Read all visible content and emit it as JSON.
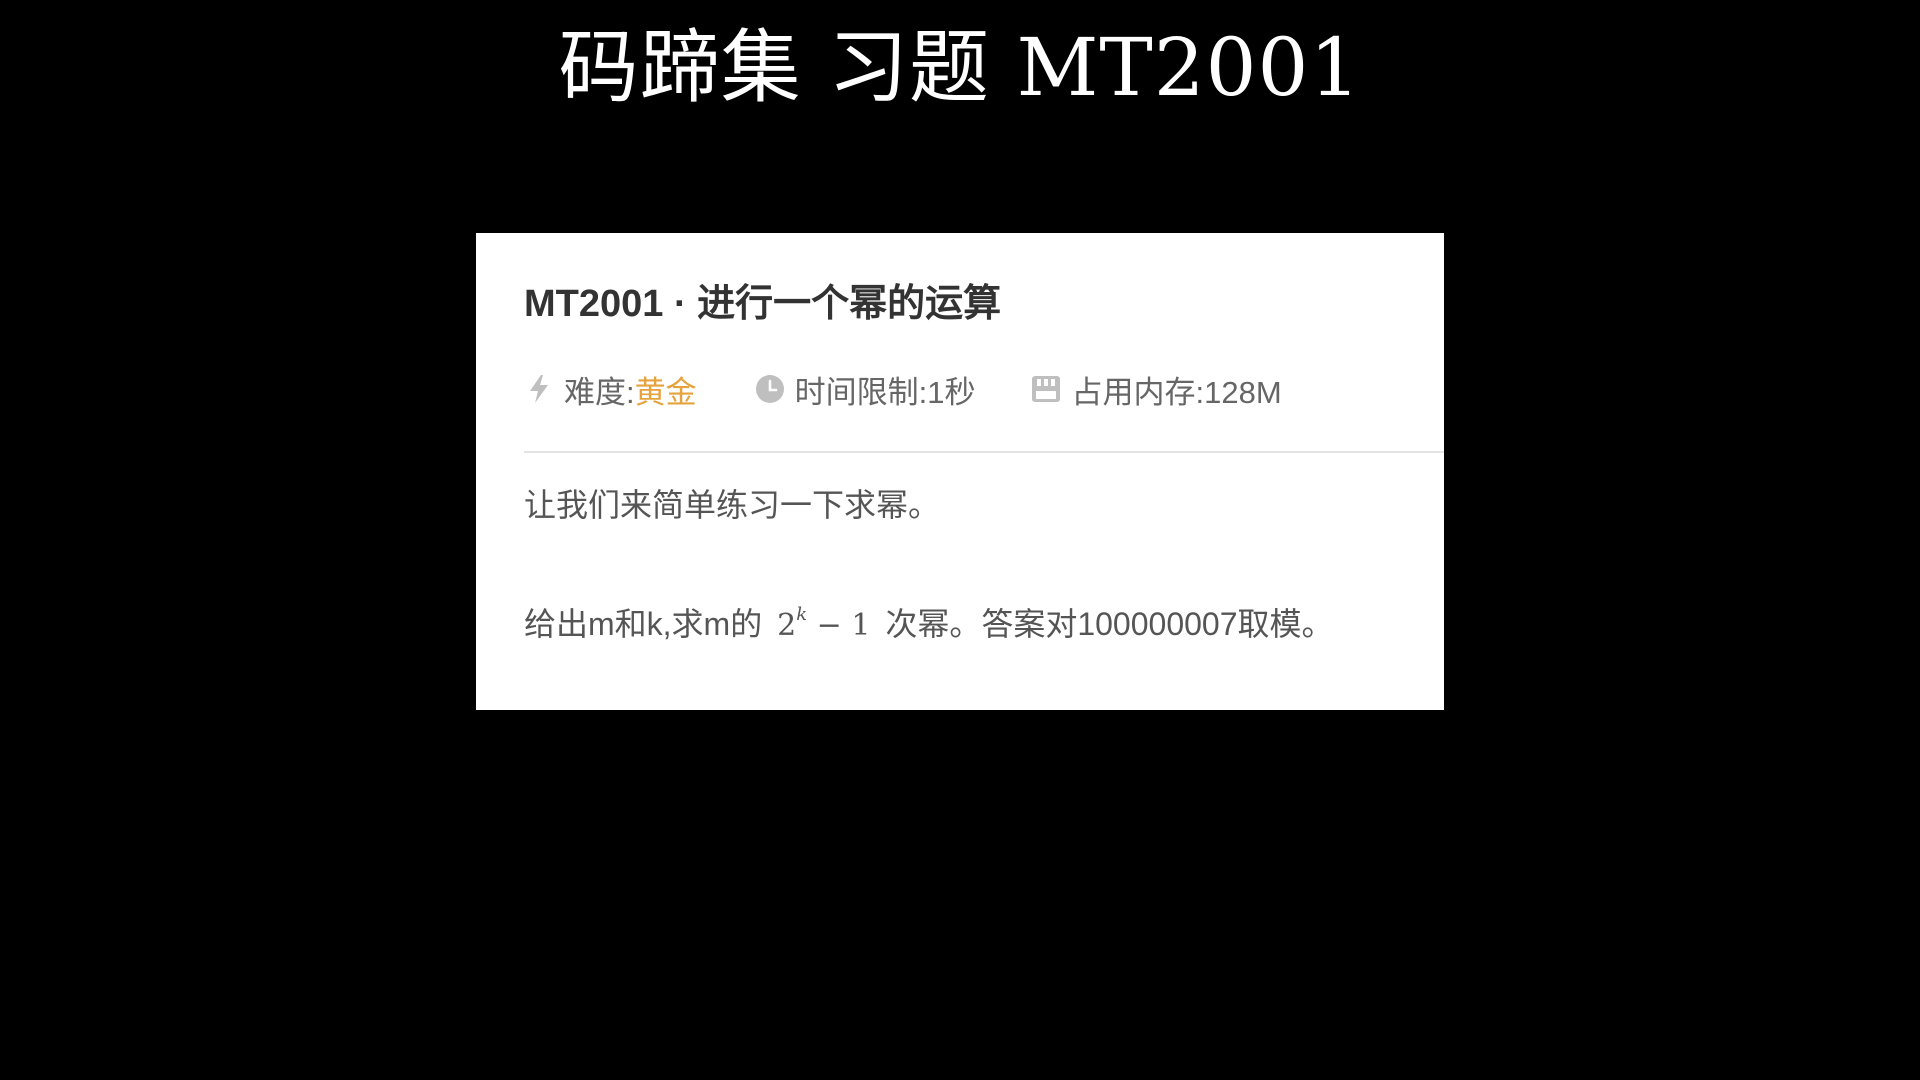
{
  "slide": {
    "title": "码蹄集 习题 MT2001"
  },
  "problem": {
    "title": "MT2001 · 进行一个幂的运算",
    "difficulty_label": "难度:",
    "difficulty_value": "黄金",
    "time_limit": "时间限制:1秒",
    "memory_limit": "占用内存:128M",
    "intro": "让我们来简单练习一下求幂。",
    "statement_prefix": "给出m和k,求m的",
    "math_base": "2",
    "math_exponent": "k",
    "math_tail": "− 1",
    "statement_suffix": "次幂。答案对100000007取模。"
  },
  "icons": {
    "difficulty": "lightning-icon",
    "time": "clock-icon",
    "memory": "memory-chip-icon"
  },
  "colors": {
    "background": "#000000",
    "card": "#ffffff",
    "difficulty_accent": "#e6a23c",
    "title_text": "#333333",
    "meta_text": "#666666",
    "icon": "#bfbfbf"
  }
}
